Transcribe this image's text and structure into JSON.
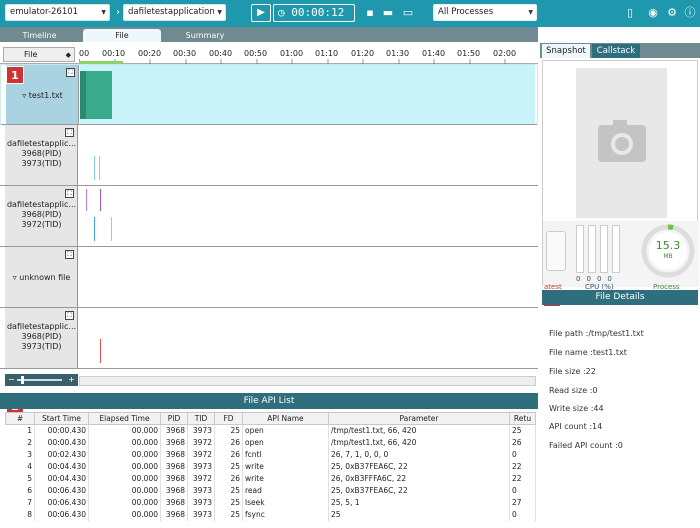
{
  "toolbar": {
    "device": "emulator-26101",
    "app": "dafiletestapplication",
    "timer": "00:00:12",
    "process": "All Processes"
  },
  "tabs": [
    "Timeline",
    "File",
    "Summary"
  ],
  "ruler": {
    "file_header": "File",
    "ticks": [
      "00",
      "00:10",
      "00:20",
      "00:30",
      "00:40",
      "00:50",
      "01:00",
      "01:10",
      "01:20",
      "01:30",
      "01:40",
      "01:50",
      "02:00"
    ]
  },
  "rows": [
    {
      "label": "test1.txt"
    },
    {
      "label": "dafiletestapplic...",
      "pid": "3968(PID)",
      "tid": "3973(TID)"
    },
    {
      "label": "dafiletestapplic...",
      "pid": "3968(PID)",
      "tid": "3972(TID)"
    },
    {
      "label": "unknown file"
    },
    {
      "label": "dafiletestapplic...",
      "pid": "3968(PID)",
      "tid": "3973(TID)"
    }
  ],
  "badges": [
    "1",
    "2",
    "3"
  ],
  "api_list": {
    "title": "File API List",
    "headers": [
      "#",
      "Start Time",
      "Elapsed Time",
      "PID",
      "TID",
      "FD",
      "API Name",
      "Parameter",
      "Retu"
    ],
    "rows": [
      [
        "1",
        "00:00.430",
        "00.000",
        "3968",
        "3973",
        "25",
        "open",
        "/tmp/test1.txt, 66, 420",
        "25"
      ],
      [
        "2",
        "00:00.430",
        "00.000",
        "3968",
        "3972",
        "26",
        "open",
        "/tmp/test1.txt, 66, 420",
        "26"
      ],
      [
        "3",
        "00:02.430",
        "00.000",
        "3968",
        "3972",
        "26",
        "fcntl",
        "26, 7, 1, 0, 0, 0",
        "0"
      ],
      [
        "4",
        "00:04.430",
        "00.000",
        "3968",
        "3973",
        "25",
        "write",
        "25, 0xB37FEA6C, 22",
        "22"
      ],
      [
        "5",
        "00:04.430",
        "00.000",
        "3968",
        "3972",
        "26",
        "write",
        "26, 0xB3FFFA6C, 22",
        "22"
      ],
      [
        "6",
        "00:06.430",
        "00.000",
        "3968",
        "3973",
        "25",
        "read",
        "25, 0xB37FEA6C, 22",
        "0"
      ],
      [
        "7",
        "00:06.430",
        "00.000",
        "3968",
        "3973",
        "25",
        "lseek",
        "25, 5, 1",
        "27"
      ],
      [
        "8",
        "00:06.430",
        "00.000",
        "3968",
        "3973",
        "25",
        "fsync",
        "25",
        "0"
      ]
    ]
  },
  "right_panel": {
    "tabs": [
      "Snapshot",
      "Callstack"
    ],
    "cpu_values": [
      "0",
      "0",
      "0",
      "0"
    ],
    "cpu_label": "CPU (%)",
    "latest_label": "atest",
    "memory": {
      "value": "15.3",
      "unit": "MB",
      "label": "Process"
    },
    "details_title": "File Details",
    "details": {
      "path": "File path :/tmp/test1.txt",
      "name": "File name :test1.txt",
      "size": "File size :22",
      "read": "Read size :0",
      "write": "Write size :44",
      "api_count": "API count :14",
      "failed": "Failed API count :0"
    }
  }
}
